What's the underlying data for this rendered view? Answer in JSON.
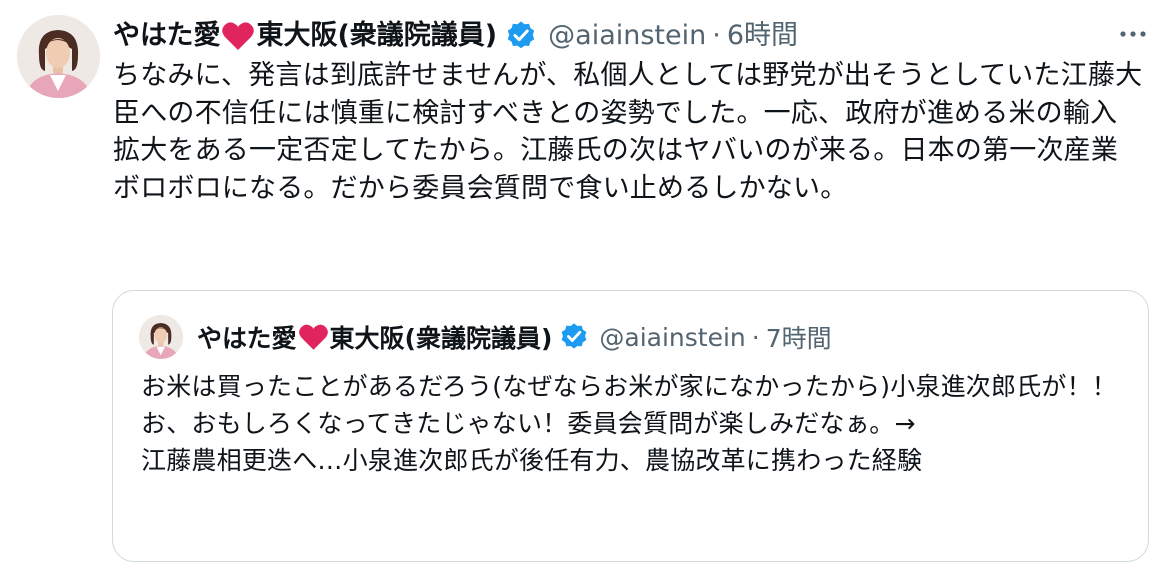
{
  "tweet": {
    "author": {
      "name_part1": "やはた愛",
      "name_part2": "東大阪(衆議院議員)",
      "handle": "@aiainstein",
      "separator": "·",
      "time": "6時間"
    },
    "text": "ちなみに、発言は到底許せませんが、私個人としては野党が出そうとしていた江藤大臣への不信任には慎重に検討すべきとの姿勢でした。一応、政府が進める米の輸入拡大をある一定否定してたから。江藤氏の次はヤバいのが来る。日本の第一次産業ボロボロになる。だから委員会質問で食い止めるしかない。"
  },
  "quoted_tweet": {
    "author": {
      "name_part1": "やはた愛",
      "name_part2": "東大阪(衆議院議員)",
      "handle": "@aiainstein",
      "separator": "·",
      "time": "7時間"
    },
    "text": "お米は買ったことがあるだろう(なぜならお米が家になかったから)小泉進次郎氏が！！お、おもしろくなってきたじゃない！委員会質問が楽しみだなぁ。→\n江藤農相更迭へ…小泉進次郎氏が後任有力、農協改革に携わった経験"
  },
  "colors": {
    "text": "#0f1419",
    "secondary": "#536471",
    "verified": "#1d9bf0",
    "heart": "#e0245e",
    "border": "#cfd9de"
  },
  "icons": {
    "heart": "heart-icon",
    "verified": "verified-badge-icon",
    "more": "more-options-icon"
  }
}
